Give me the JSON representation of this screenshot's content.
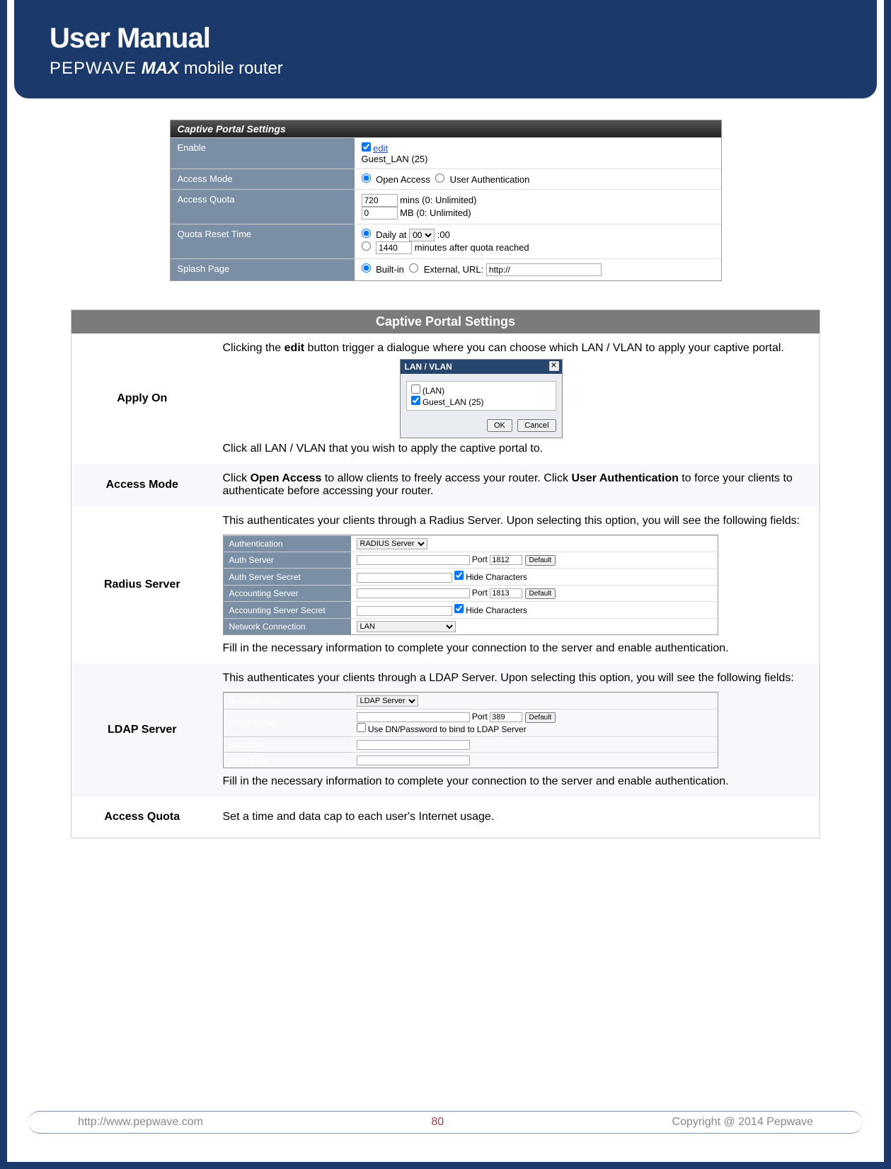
{
  "header": {
    "title": "User Manual",
    "brand": "PEPWAVE",
    "max": "MAX",
    "tag": "mobile router"
  },
  "captive_panel": {
    "header": "Captive Portal Settings",
    "rows": {
      "enable": {
        "label": "Enable",
        "edit_link": "edit",
        "vlan": "Guest_LAN (25)"
      },
      "access_mode": {
        "label": "Access Mode",
        "opt1": "Open Access",
        "opt2": "User Authentication"
      },
      "access_quota": {
        "label": "Access Quota",
        "mins_val": "720",
        "mins_suffix": "mins (0: Unlimited)",
        "mb_val": "0",
        "mb_suffix": "MB (0: Unlimited)"
      },
      "quota_reset": {
        "label": "Quota Reset Time",
        "daily_label": "Daily at",
        "hour_val": "00",
        "hour_suffix": ":00",
        "mins_val": "1440",
        "mins_label": "minutes after quota reached"
      },
      "splash": {
        "label": "Splash Page",
        "opt1": "Built-in",
        "opt2": "External, URL:",
        "url_val": "http://"
      }
    }
  },
  "desc": {
    "header": "Captive Portal Settings",
    "apply_on": {
      "head": "Apply On",
      "intro_a": "Clicking the ",
      "intro_b": "edit",
      "intro_c": " button trigger a dialogue where you can choose which LAN / VLAN to apply your captive portal.",
      "dialog": {
        "title": "LAN / VLAN",
        "opt1": "(LAN)",
        "opt2": "Guest_LAN (25)",
        "ok": "OK",
        "cancel": "Cancel"
      },
      "outro": "Click all LAN / VLAN that you wish to apply the captive portal to."
    },
    "access_mode": {
      "head": "Access Mode",
      "txt_a": "Click ",
      "txt_b": "Open Access",
      "txt_c": " to allow clients to freely access your router. Click ",
      "txt_d": "User Authentication",
      "txt_e": " to force your clients to authenticate before accessing your router."
    },
    "radius": {
      "head": "Radius Server",
      "intro": "This authenticates your clients through a Radius Server. Upon selecting this option, you will see the following fields:",
      "fields": {
        "auth_label": "Authentication",
        "auth_val": "RADIUS Server",
        "auth_server_label": "Auth Server",
        "port_label": "Port",
        "auth_port": "1812",
        "default_btn": "Default",
        "auth_secret_label": "Auth Server Secret",
        "hide_chars": "Hide Characters",
        "acct_server_label": "Accounting Server",
        "acct_port": "1813",
        "acct_secret_label": "Accounting Server Secret",
        "net_conn_label": "Network Connection",
        "net_conn_val": "LAN"
      },
      "outro": "Fill in the necessary information to complete your connection to the server and enable authentication."
    },
    "ldap": {
      "head": "LDAP Server",
      "intro": "This authenticates your clients through a LDAP Server. Upon selecting this option, you will see the following fields:",
      "fields": {
        "auth_label": "Authentication",
        "auth_val": "LDAP Server",
        "ldap_server_label": "LDAP Server",
        "port_label": "Port",
        "ldap_port": "389",
        "default_btn": "Default",
        "use_dn": "Use DN/Password to bind to LDAP Server",
        "base_dn_label": "Base DN",
        "base_filter_label": "Base Filter"
      },
      "outro": "Fill in the necessary information to complete your connection to the server and enable authentication."
    },
    "access_quota": {
      "head": "Access Quota",
      "txt": "Set a time and data cap to each user's Internet usage."
    }
  },
  "footer": {
    "url": "http://www.pepwave.com",
    "page": "80",
    "copyright": "Copyright @ 2014 Pepwave"
  }
}
